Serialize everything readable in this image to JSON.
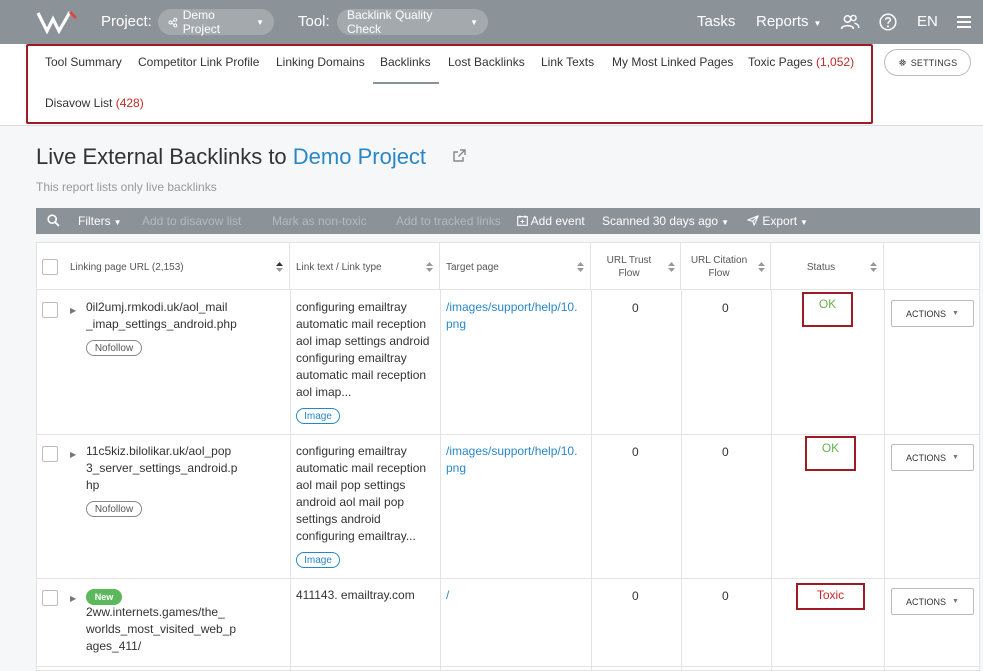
{
  "topbar": {
    "project_label": "Project:",
    "project_value": "Demo Project",
    "tool_label": "Tool:",
    "tool_value": "Backlink Quality Check",
    "tasks": "Tasks",
    "reports": "Reports",
    "lang": "EN",
    "icons": [
      "logo-w",
      "share-icon",
      "users-icon",
      "help-icon",
      "menu-icon"
    ]
  },
  "subnav": {
    "tabs": [
      {
        "label": "Tool Summary"
      },
      {
        "label": "Competitor Link Profile"
      },
      {
        "label": "Linking Domains"
      },
      {
        "label": "Backlinks",
        "active": true
      },
      {
        "label": "Lost Backlinks"
      },
      {
        "label": "Link Texts"
      },
      {
        "label": "My Most Linked Pages"
      },
      {
        "label": "Toxic Pages",
        "count": "(1,052)"
      },
      {
        "label": "Disavow List",
        "count": "(428)"
      }
    ],
    "settings": "SETTINGS"
  },
  "page": {
    "title_prefix": "Live External Backlinks to ",
    "title_project": "Demo Project",
    "subtitle": "This report lists only live backlinks"
  },
  "toolbar": {
    "filters": "Filters",
    "add_disavow": "Add to disavow list",
    "mark_nontoxic": "Mark as non-toxic",
    "add_tracked": "Add to tracked links",
    "add_event": "Add event",
    "scanned": "Scanned 30 days ago",
    "export": "Export"
  },
  "table": {
    "headers": {
      "url": "Linking page URL (2,153)",
      "link_text": "Link text / Link type",
      "target": "Target page",
      "trust_1": "URL Trust",
      "trust_2": "Flow",
      "citation_1": "URL Citation",
      "citation_2": "Flow",
      "status": "Status"
    },
    "actions_label": "ACTIONS",
    "rows": [
      {
        "url_lines": [
          "0il2umj.rmkodi.uk/aol_mail",
          "_imap_settings_android.php"
        ],
        "url_tag": "Nofollow",
        "text_lines": [
          "configuring emailtray",
          "automatic mail reception",
          "aol imap settings android",
          "configuring emailtray",
          "automatic mail reception",
          "aol imap..."
        ],
        "text_tag": "Image",
        "target_lines": [
          "/images/support/help/10.",
          "png"
        ],
        "trust": "0",
        "citation": "0",
        "status": "OK"
      },
      {
        "url_lines": [
          "11c5kiz.bilolikar.uk/aol_pop",
          "3_server_settings_android.p",
          "hp"
        ],
        "url_tag": "Nofollow",
        "text_lines": [
          "configuring emailtray",
          "automatic mail reception",
          "aol mail pop settings",
          "android aol mail pop",
          "settings android",
          "configuring emailtray..."
        ],
        "text_tag": "Image",
        "target_lines": [
          "/images/support/help/10.",
          "png"
        ],
        "trust": "0",
        "citation": "0",
        "status": "OK"
      },
      {
        "new_tag": "New",
        "url_lines": [
          "2ww.internets.games/the_",
          "worlds_most_visited_web_p",
          "ages_411/"
        ],
        "text_lines": [
          "411143. emailtray.com"
        ],
        "target_lines": [
          "/"
        ],
        "trust": "0",
        "citation": "0",
        "status": "Toxic"
      }
    ]
  }
}
